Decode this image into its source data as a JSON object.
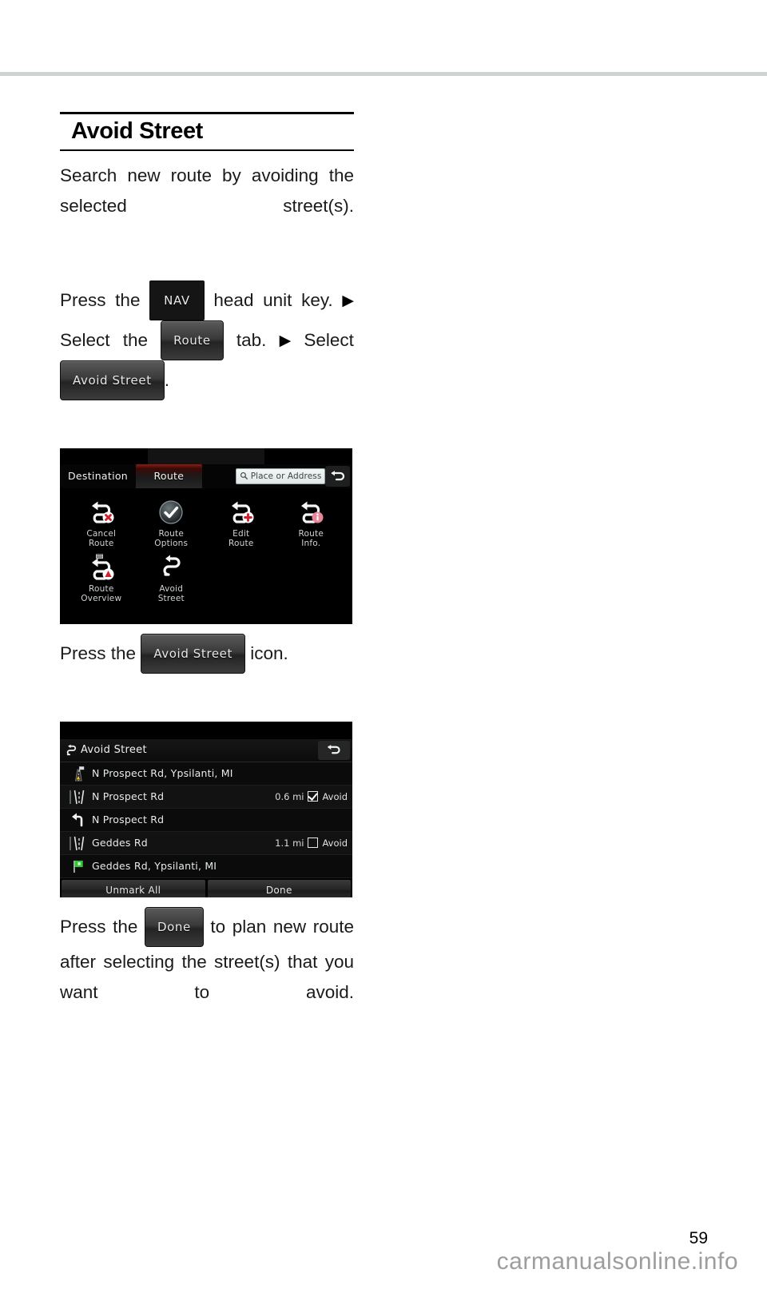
{
  "page": {
    "number": "59",
    "watermark": "carmanualsonline.info"
  },
  "section": {
    "title": "Avoid Street",
    "intro": "Search new route by avoiding the selected street(s).",
    "steps": {
      "press_the": "Press the",
      "nav_key": "NAV",
      "head_unit_key": "head unit key.",
      "select": "Select",
      "the": "the",
      "route_tab": "Route",
      "tab_word": "tab.",
      "select_2": "Select",
      "avoid_street_btn": "Avoid Street",
      "period": "."
    },
    "caption_icon": {
      "press_the": "Press the",
      "button": "Avoid Street",
      "icon_word": "icon."
    },
    "closing": {
      "press_the": "Press the",
      "button": "Done",
      "rest": "to plan new route after selecting the street(s) that you want to avoid."
    }
  },
  "device_route_menu": {
    "tabs": [
      {
        "label": "Destination",
        "selected": false
      },
      {
        "label": "Route",
        "selected": true
      }
    ],
    "search": {
      "placeholder": "Place or Address",
      "icon": "search-icon"
    },
    "back_icon": "back-arrow-icon",
    "items": [
      {
        "icon": "cancel-route-icon",
        "line1": "Cancel",
        "line2": "Route"
      },
      {
        "icon": "route-options-icon",
        "line1": "Route",
        "line2": "Options"
      },
      {
        "icon": "edit-route-icon",
        "line1": "Edit",
        "line2": "Route"
      },
      {
        "icon": "route-info-icon",
        "line1": "Route",
        "line2": "Info."
      },
      {
        "icon": "route-overview-icon",
        "line1": "Route",
        "line2": "Overview"
      },
      {
        "icon": "avoid-street-icon",
        "line1": "Avoid",
        "line2": "Street"
      }
    ]
  },
  "device_avoid_list": {
    "header": {
      "icon": "avoid-street-icon",
      "title": "Avoid Street",
      "back_icon": "back-arrow-icon"
    },
    "rows": [
      {
        "icon": "start-flag-icon",
        "name": "N Prospect Rd, Ypsilanti, MI",
        "distance": "",
        "avoid_label": "",
        "checked": null
      },
      {
        "icon": "road-icon",
        "name": "N Prospect Rd",
        "distance": "0.6 mi",
        "avoid_label": "Avoid",
        "checked": true
      },
      {
        "icon": "turn-left-icon",
        "name": "N Prospect Rd",
        "distance": "",
        "avoid_label": "",
        "checked": null
      },
      {
        "icon": "road-icon",
        "name": "Geddes Rd",
        "distance": "1.1 mi",
        "avoid_label": "Avoid",
        "checked": false
      },
      {
        "icon": "destination-flag-icon",
        "name": "Geddes Rd, Ypsilanti, MI",
        "distance": "",
        "avoid_label": "",
        "checked": null
      }
    ],
    "buttons": [
      {
        "label": "Unmark All"
      },
      {
        "label": "Done"
      }
    ]
  },
  "colors": {
    "rule": "#ccd4d4",
    "accent_tab": "#8e1a12",
    "marker_green": "#2ecc2e",
    "marker_red": "#d0202e"
  }
}
